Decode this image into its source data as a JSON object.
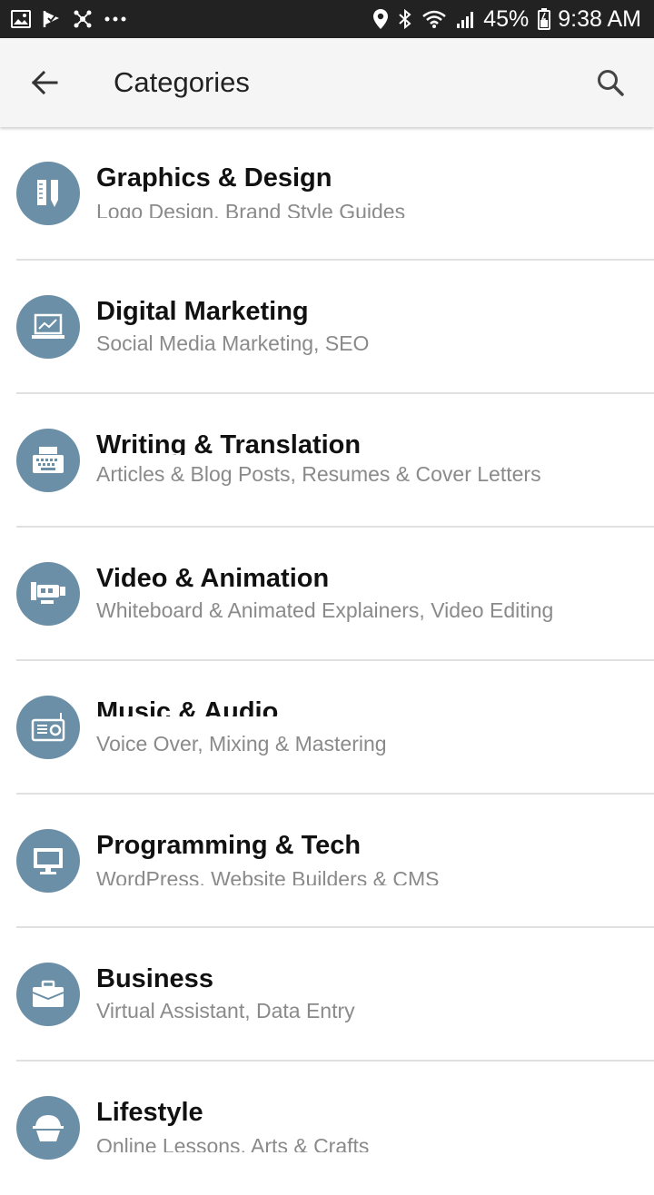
{
  "status_bar": {
    "battery": "45%",
    "time": "9:38 AM",
    "left_icons": [
      "image-icon",
      "check-flag-icon",
      "hub-icon",
      "more-icon"
    ],
    "right_icons": [
      "location-icon",
      "bluetooth-icon",
      "wifi-icon",
      "signal-icon",
      "battery-icon"
    ]
  },
  "app_bar": {
    "title": "Categories"
  },
  "categories": [
    {
      "name": "Graphics & Design",
      "sub": "Logo Design, Brand Style Guides",
      "icon": "pencil-ruler-icon"
    },
    {
      "name": "Digital Marketing",
      "sub": "Social Media Marketing, SEO",
      "icon": "laptop-chart-icon"
    },
    {
      "name": "Writing & Translation",
      "sub": "Articles & Blog Posts, Resumes & Cover Letters",
      "icon": "typewriter-icon"
    },
    {
      "name": "Video & Animation",
      "sub": "Whiteboard & Animated Explainers, Video Editing",
      "icon": "video-camera-icon"
    },
    {
      "name": "Music & Audio",
      "sub": "Voice Over, Mixing & Mastering",
      "icon": "radio-icon"
    },
    {
      "name": "Programming & Tech",
      "sub": "WordPress, Website Builders & CMS",
      "icon": "monitor-icon"
    },
    {
      "name": "Business",
      "sub": "Virtual Assistant, Data Entry",
      "icon": "briefcase-icon"
    },
    {
      "name": "Lifestyle",
      "sub": "Online Lessons, Arts & Crafts",
      "icon": "cupcake-icon"
    }
  ],
  "colors": {
    "status_bar_bg": "#222222",
    "app_bar_bg": "#f5f5f5",
    "avatar_bg": "#6b8fa7",
    "title_text": "#111111",
    "sub_text": "#8a8a8a"
  }
}
